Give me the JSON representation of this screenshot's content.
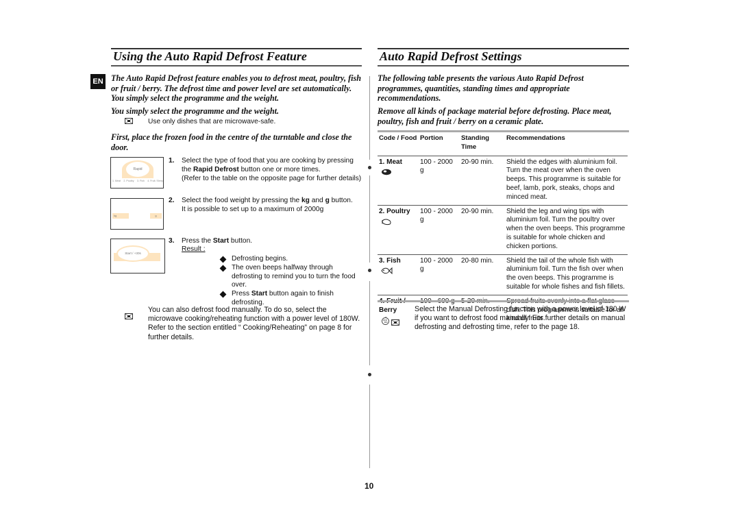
{
  "page_number": "10",
  "left": {
    "title": "Using the Auto Rapid Defrost Feature",
    "language_badge": "EN",
    "intro": "The Auto Rapid Defrost feature enables you to defrost meat, poultry, fish or fruit / berry.  The defrost time and power level are set automatically.  You simply select the programme and the weight.",
    "subheading": "You simply select the programme and the weight.",
    "note_dishes": "Use only dishes that are microwave-safe.",
    "first_instruction": "First, place the frozen food in the centre of the turntable and close the door.",
    "steps": [
      {
        "number": "1.",
        "text_before": "Select the type of food that you are cooking by pressing the ",
        "bold": "Rapid Defrost",
        "text_after": " button one or more times.",
        "extra": "(Refer to the table on the opposite page for further details)",
        "panel": {
          "button_label": "Rapid",
          "options": [
            "1. Meat",
            "2. Poultry",
            "3. Fish",
            "4. Fruit / Berry"
          ]
        }
      },
      {
        "number": "2.",
        "text_before": "Select the food weight by pressing the ",
        "bold1": "kg",
        "text_mid": " and ",
        "bold2": "g",
        "text_after": " button.",
        "extra": "It is possible to set up to a maximum of 2000g",
        "panel": {
          "left_button": "kg",
          "right_button": "g"
        }
      },
      {
        "number": "3.",
        "text_before": "Press the ",
        "bold": "Start",
        "text_after": " button.",
        "result_label": "Result :",
        "panel": {
          "button_label": "Start / +30s"
        },
        "results": [
          {
            "text": "Defrosting begins."
          },
          {
            "text": "The oven beeps halfway through defrosting to remind you to turn the food over."
          },
          {
            "text_before": "Press ",
            "bold": "Start",
            "text_after": " button again to finish defrosting."
          }
        ]
      }
    ],
    "note_manual": "You can also defrost food manually. To do so, select the microwave cooking/reheating function with a power level of 180W. Refer to the section entitled “ Cooking/Reheating” on page 8 for further details."
  },
  "right": {
    "title": "Auto Rapid Defrost Settings",
    "intro": "The following table presents the various Auto Rapid Defrost programmes, quantities, standing times and appropriate recommendations.",
    "instruction": "Remove all kinds of package material before defrosting. Place meat, poultry, fish and fruit / berry on a ceramic plate.",
    "table": {
      "headers": [
        "Code / Food",
        "Portion",
        "Standing Time",
        "Recommendations"
      ],
      "rows": [
        {
          "food": "1. Meat",
          "icon": "meat-icon",
          "portion": "100 - 2000 g",
          "standing": "20-90 min.",
          "rec": "Shield the edges with aluminium foil. Turn the meat over when the oven beeps. This programme is suitable for beef, lamb, pork, steaks, chops and minced meat."
        },
        {
          "food": "2. Poultry",
          "icon": "poultry-icon",
          "portion": "100 - 2000 g",
          "standing": "20-90 min.",
          "rec": "Shield the leg and wing tips with aluminium foil. Turn the poultry over when the oven beeps. This programme is suitable for whole chicken and chicken portions."
        },
        {
          "food": "3. Fish",
          "icon": "fish-icon",
          "portion": "100 - 2000 g",
          "standing": "20-80 min.",
          "rec": "Shield the tail of the whole fish with aluminium foil. Turn the fish over when the oven beeps. This programme is suitable for whole fishes and fish fillets."
        },
        {
          "food": "4. Fruit / Berry",
          "icon": "fruit-icon",
          "portion": "100 - 600 g",
          "standing": "5-20 min.",
          "rec": "Spread fruits evenly into a flat glass dish. This programme is suitable for all kind of fruits."
        }
      ]
    },
    "note_manual": "Select the Manual Defrosting function with a power level of 180 W if you want to defrost food manually. For further details on manual defrosting and defrosting time, refer to the page 18."
  }
}
